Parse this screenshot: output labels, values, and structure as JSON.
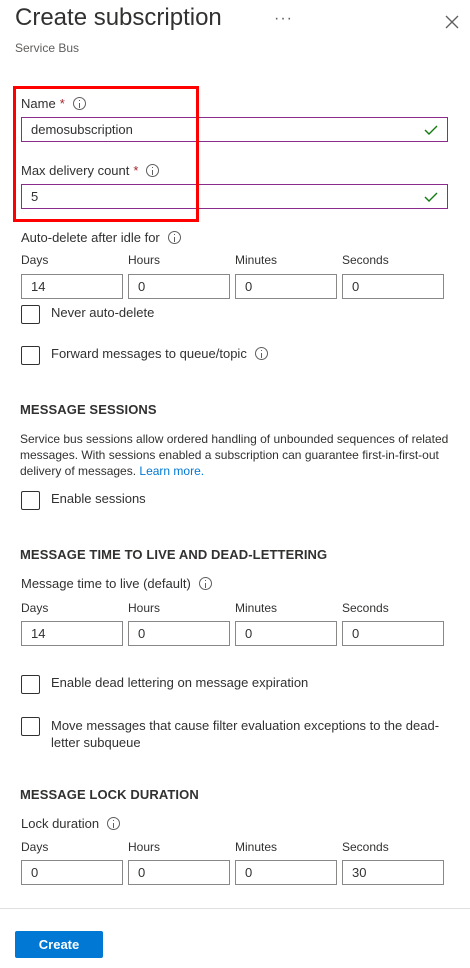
{
  "header": {
    "title": "Create subscription",
    "subtitle": "Service Bus",
    "more_label": "···"
  },
  "name_field": {
    "label": "Name",
    "required": "*",
    "value": "demosubscription"
  },
  "max_delivery": {
    "label": "Max delivery count",
    "required": "*",
    "value": "5"
  },
  "auto_delete": {
    "label": "Auto-delete after idle for",
    "units": [
      "Days",
      "Hours",
      "Minutes",
      "Seconds"
    ],
    "values": [
      "14",
      "0",
      "0",
      "0"
    ],
    "never_label": "Never auto-delete"
  },
  "forward": {
    "label": "Forward messages to queue/topic"
  },
  "sessions": {
    "heading": "MESSAGE SESSIONS",
    "description": "Service bus sessions allow ordered handling of unbounded sequences of related messages. With sessions enabled a subscription can guarantee first-in-first-out delivery of messages.",
    "link": "Learn more.",
    "enable_label": "Enable sessions"
  },
  "ttl": {
    "heading": "MESSAGE TIME TO LIVE AND DEAD-LETTERING",
    "label": "Message time to live (default)",
    "units": [
      "Days",
      "Hours",
      "Minutes",
      "Seconds"
    ],
    "values": [
      "14",
      "0",
      "0",
      "0"
    ],
    "dead_letter_label": "Enable dead lettering on message expiration",
    "filter_label": "Move messages that cause filter evaluation exceptions to the dead-letter subqueue"
  },
  "lock": {
    "heading": "MESSAGE LOCK DURATION",
    "label": "Lock duration",
    "units": [
      "Days",
      "Hours",
      "Minutes",
      "Seconds"
    ],
    "values": [
      "0",
      "0",
      "0",
      "30"
    ]
  },
  "footer": {
    "create_label": "Create"
  },
  "colors": {
    "accent": "#0078d4",
    "valid_border": "#8a2c8c",
    "check": "#107c10",
    "highlight": "#ff0000",
    "required": "#a4262c"
  }
}
